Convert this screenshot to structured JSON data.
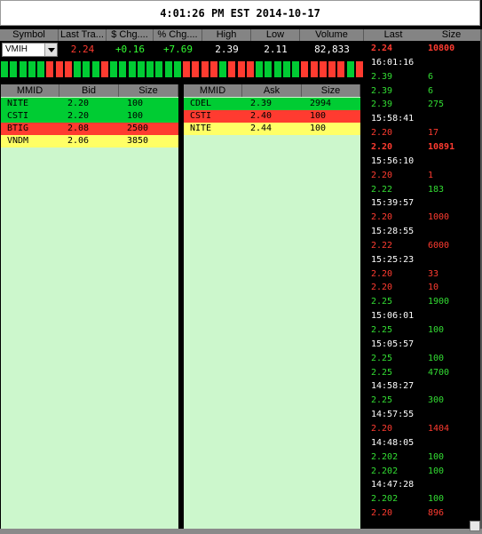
{
  "title": "4:01:26 PM EST 2014-10-17",
  "quote": {
    "headers": [
      "Symbol",
      "Last Tra...",
      "$ Chg....",
      "% Chg....",
      "High",
      "Low",
      "Volume"
    ],
    "symbol": "VMIH",
    "last": "2.24",
    "chg": "+0.16",
    "pct": "+7.69",
    "high": "2.39",
    "low": "2.11",
    "volume": "82,833"
  },
  "colors": {
    "green": "#00cc33",
    "red": "#ff3b30",
    "yellow": "#ffff66",
    "panel": "#ccf7cc"
  },
  "tick_history": [
    "green",
    "green",
    "green",
    "green",
    "green",
    "red",
    "red",
    "red",
    "green",
    "green",
    "green",
    "red",
    "green",
    "green",
    "green",
    "green",
    "green",
    "green",
    "green",
    "green",
    "red",
    "red",
    "red",
    "red",
    "green",
    "red",
    "red",
    "red",
    "green",
    "green",
    "green",
    "green",
    "green",
    "red",
    "red",
    "red",
    "red",
    "red",
    "green",
    "red"
  ],
  "bid": {
    "headers": [
      "MMID",
      "Bid",
      "Size"
    ],
    "rows": [
      {
        "mmid": "NITE",
        "price": "2.20",
        "size": "100",
        "color": "green"
      },
      {
        "mmid": "CSTI",
        "price": "2.20",
        "size": "100",
        "color": "green"
      },
      {
        "mmid": "BTIG",
        "price": "2.08",
        "size": "2500",
        "color": "red"
      },
      {
        "mmid": "VNDM",
        "price": "2.06",
        "size": "3850",
        "color": "yellow"
      }
    ]
  },
  "ask": {
    "headers": [
      "MMID",
      "Ask",
      "Size"
    ],
    "rows": [
      {
        "mmid": "CDEL",
        "price": "2.39",
        "size": "2994",
        "color": "green"
      },
      {
        "mmid": "CSTI",
        "price": "2.40",
        "size": "100",
        "color": "red"
      },
      {
        "mmid": "NITE",
        "price": "2.44",
        "size": "100",
        "color": "yellow"
      }
    ]
  },
  "time_sales": {
    "headers": [
      "Last",
      "Size"
    ],
    "rows": [
      {
        "price": "2.24",
        "size": "10800",
        "color": "red",
        "bold": true
      },
      {
        "time": "16:01:16"
      },
      {
        "price": "2.39",
        "size": "6",
        "color": "green"
      },
      {
        "price": "2.39",
        "size": "6",
        "color": "green"
      },
      {
        "price": "2.39",
        "size": "275",
        "color": "green"
      },
      {
        "time": "15:58:41"
      },
      {
        "price": "2.20",
        "size": "17",
        "color": "red"
      },
      {
        "price": "2.20",
        "size": "10891",
        "color": "red",
        "bold": true
      },
      {
        "time": "15:56:10"
      },
      {
        "price": "2.20",
        "size": "1",
        "color": "red"
      },
      {
        "price": "2.22",
        "size": "183",
        "color": "green"
      },
      {
        "time": "15:39:57"
      },
      {
        "price": "2.20",
        "size": "1000",
        "color": "red"
      },
      {
        "time": "15:28:55"
      },
      {
        "price": "2.22",
        "size": "6000",
        "color": "red"
      },
      {
        "time": "15:25:23"
      },
      {
        "price": "2.20",
        "size": "33",
        "color": "red"
      },
      {
        "price": "2.20",
        "size": "10",
        "color": "red"
      },
      {
        "price": "2.25",
        "size": "1900",
        "color": "green"
      },
      {
        "time": "15:06:01"
      },
      {
        "price": "2.25",
        "size": "100",
        "color": "green"
      },
      {
        "time": "15:05:57"
      },
      {
        "price": "2.25",
        "size": "100",
        "color": "green"
      },
      {
        "price": "2.25",
        "size": "4700",
        "color": "green"
      },
      {
        "time": "14:58:27"
      },
      {
        "price": "2.25",
        "size": "300",
        "color": "green"
      },
      {
        "time": "14:57:55"
      },
      {
        "price": "2.20",
        "size": "1404",
        "color": "red"
      },
      {
        "time": "14:48:05"
      },
      {
        "price": "2.202",
        "size": "100",
        "color": "green"
      },
      {
        "price": "2.202",
        "size": "100",
        "color": "green"
      },
      {
        "time": "14:47:28"
      },
      {
        "price": "2.202",
        "size": "100",
        "color": "green"
      },
      {
        "price": "2.20",
        "size": "896",
        "color": "red"
      }
    ]
  }
}
